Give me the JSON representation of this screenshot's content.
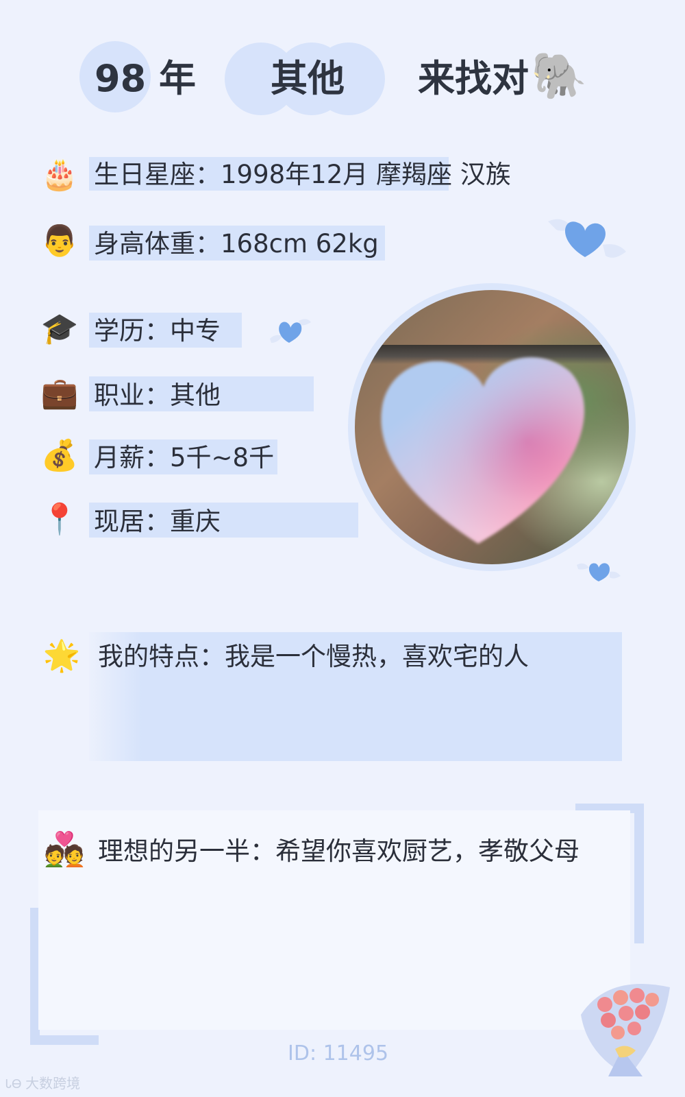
{
  "header": {
    "year_number": "98",
    "year_label": "年",
    "job": "其他",
    "seeking": "来找对",
    "zodiac_icon": "🐘"
  },
  "info": [
    {
      "icon": "🎂",
      "icon_name": "birthday-cake-icon",
      "text": "生日星座：1998年12月 摩羯座 汉族"
    },
    {
      "icon": "👨",
      "icon_name": "man-face-icon",
      "text": "身高体重：168cm 62kg"
    },
    {
      "icon": "🎓",
      "icon_name": "graduation-cap-icon",
      "text": "学历：中专"
    },
    {
      "icon": "💼",
      "icon_name": "briefcase-icon",
      "text": "职业：其他"
    },
    {
      "icon": "💰",
      "icon_name": "money-bag-icon",
      "text": "月薪：5千~8千"
    },
    {
      "icon": "📍",
      "icon_name": "location-pin-icon",
      "text": "现居：重庆"
    }
  ],
  "feature": {
    "icon": "🌟",
    "text": "我的特点：我是一个慢热，喜欢宅的人"
  },
  "ideal": {
    "icon": "💑",
    "text": "理想的另一半：希望你喜欢厨艺，孝敬父母"
  },
  "footer": {
    "id_text": "ID: 11495",
    "watermark": "大数跨境"
  },
  "colors": {
    "background": "#eef2fd",
    "highlight": "#d6e3fb",
    "heart_blue": "#6fa3e8"
  }
}
